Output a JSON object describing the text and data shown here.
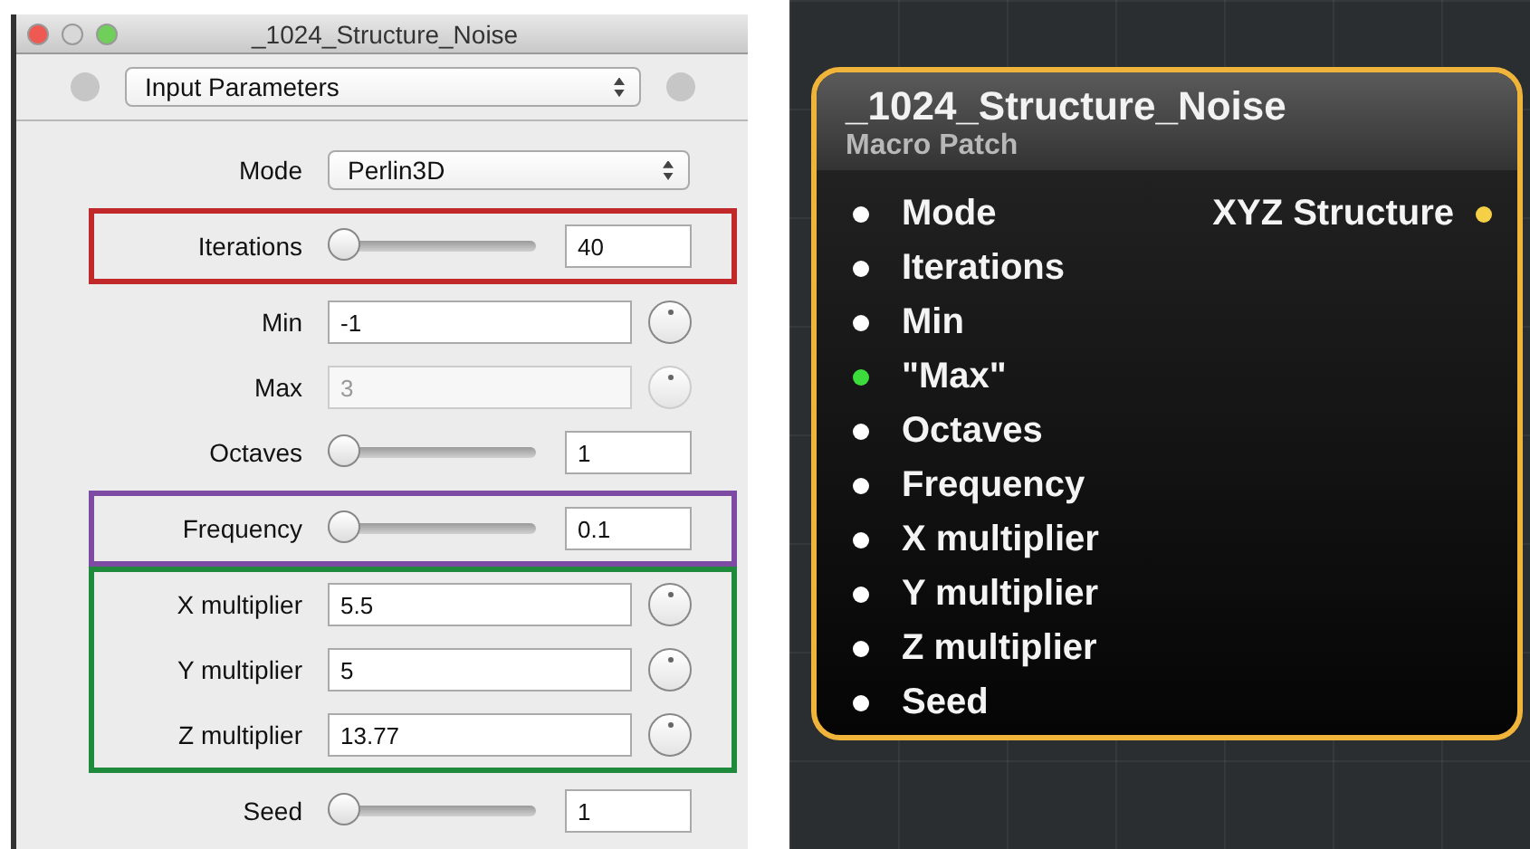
{
  "window": {
    "title": "_1024_Structure_Noise"
  },
  "toolbar": {
    "popup": "Input Parameters"
  },
  "sections": [
    {
      "params": [
        {
          "kind": "popup",
          "label": "Mode",
          "value": "Perlin3D",
          "disabled": false
        }
      ]
    },
    {
      "color": "#c0282a",
      "params": [
        {
          "kind": "slider",
          "label": "Iterations",
          "level": 0,
          "value": "40",
          "disabled": false
        }
      ]
    },
    {
      "params": [
        {
          "kind": "number",
          "label": "Min",
          "value": "-1",
          "disabled": false
        },
        {
          "kind": "number",
          "label": "Max",
          "value": "3",
          "disabled": true
        },
        {
          "kind": "slider",
          "label": "Octaves",
          "level": 0,
          "value": "1",
          "disabled": false
        }
      ]
    },
    {
      "color": "#7d4ba3",
      "params": [
        {
          "kind": "slider",
          "label": "Frequency",
          "level": 0,
          "value": "0.1",
          "disabled": false
        }
      ]
    },
    {
      "color": "#1f8a3c",
      "params": [
        {
          "kind": "number",
          "label": "X multiplier",
          "value": "5.5",
          "disabled": false
        },
        {
          "kind": "number",
          "label": "Y multiplier",
          "value": "5",
          "disabled": false
        },
        {
          "kind": "number",
          "label": "Z multiplier",
          "value": "13.77",
          "disabled": false
        }
      ]
    },
    {
      "params": [
        {
          "kind": "slider",
          "label": "Seed",
          "level": 0,
          "value": "1",
          "disabled": false
        }
      ]
    }
  ],
  "patch": {
    "title": "_1024_Structure_Noise",
    "subtitle": "Macro Patch",
    "inputs": [
      {
        "label": "Mode",
        "color": "#ffffff"
      },
      {
        "label": "Iterations",
        "color": "#ffffff"
      },
      {
        "label": "Min",
        "color": "#ffffff"
      },
      {
        "label": "\"Max\"",
        "color": "#3ddc3d"
      },
      {
        "label": "Octaves",
        "color": "#ffffff"
      },
      {
        "label": "Frequency",
        "color": "#ffffff"
      },
      {
        "label": "X multiplier",
        "color": "#ffffff"
      },
      {
        "label": "Y multiplier",
        "color": "#ffffff"
      },
      {
        "label": "Z multiplier",
        "color": "#ffffff"
      },
      {
        "label": "Seed",
        "color": "#ffffff"
      }
    ],
    "output": {
      "label": "XYZ Structure",
      "color": "#f5cf45"
    }
  }
}
